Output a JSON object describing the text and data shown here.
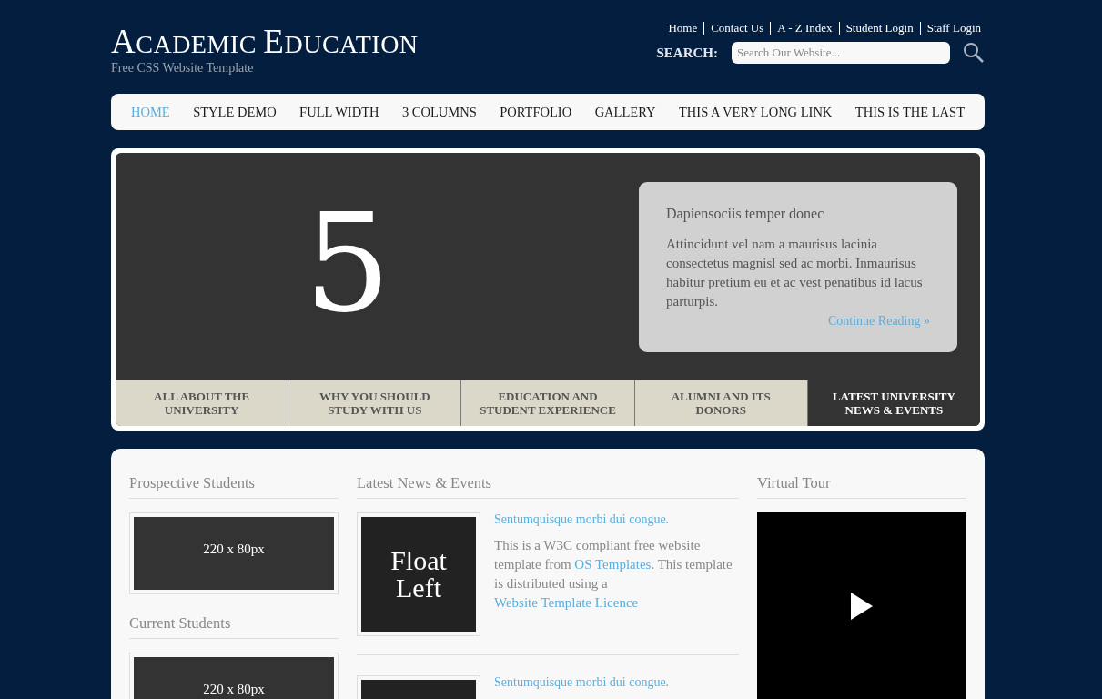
{
  "site": {
    "title": "ACADEMIC EDUCATION",
    "tagline": "Free CSS Website Template"
  },
  "top_links": [
    "Home",
    "Contact Us",
    "A - Z Index",
    "Student Login",
    "Staff Login"
  ],
  "search": {
    "label": "SEARCH:",
    "placeholder": "Search Our Website..."
  },
  "nav": [
    {
      "label": "HOME",
      "selected": true
    },
    {
      "label": "STYLE DEMO",
      "selected": false
    },
    {
      "label": "FULL WIDTH",
      "selected": false
    },
    {
      "label": "3 COLUMNS",
      "selected": false
    },
    {
      "label": "PORTFOLIO",
      "selected": false
    },
    {
      "label": "GALLERY",
      "selected": false
    },
    {
      "label": "THIS A VERY LONG LINK",
      "selected": false
    },
    {
      "label": "THIS IS THE LAST",
      "selected": false
    }
  ],
  "slider": {
    "number": "5",
    "caption": {
      "title": "Dapiensociis temper donec",
      "text": "Attincidunt vel nam a maurisus lacinia consectetus magnisl sed ac morbi. Inmaurisus habitur pretium eu et ac vest penatibus id lacus parturpis.",
      "link": "Continue Reading »"
    },
    "tabs": [
      {
        "label": "ALL ABOUT THE UNIVERSITY",
        "selected": false
      },
      {
        "label": "WHY YOU SHOULD STUDY WITH US",
        "selected": false
      },
      {
        "label": "EDUCATION AND STUDENT EXPERIENCE",
        "selected": false
      },
      {
        "label": "ALUMNI AND ITS DONORS",
        "selected": false
      },
      {
        "label": "LATEST UNIVERSITY NEWS & EVENTS",
        "selected": true
      }
    ]
  },
  "left_column": [
    {
      "heading": "Prospective Students",
      "ad": "220 x 80px"
    },
    {
      "heading": "Current Students",
      "ad": "220 x 80px"
    }
  ],
  "news": {
    "heading": "Latest News & Events",
    "items": [
      {
        "thumb": "Float Left",
        "title": "Sentumquisque morbi dui congue.",
        "body": [
          {
            "kind": "text",
            "text": "This is a W3C compliant free website template from "
          },
          {
            "kind": "link",
            "text": "OS Templates"
          },
          {
            "kind": "text",
            "text": ". This template is distributed using a "
          },
          {
            "kind": "link",
            "text": "Website Template Licence"
          }
        ]
      },
      {
        "title": "Sentumquisque morbi dui congue."
      }
    ]
  },
  "video": {
    "heading": "Virtual Tour"
  }
}
